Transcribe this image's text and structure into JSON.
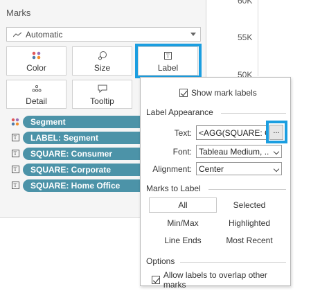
{
  "marks": {
    "title": "Marks",
    "mark_type": "Automatic",
    "tiles": [
      {
        "label": "Color"
      },
      {
        "label": "Size"
      },
      {
        "label": "Label"
      },
      {
        "label": "Detail"
      },
      {
        "label": "Tooltip"
      }
    ],
    "pills": [
      {
        "label": "Segment",
        "icon": "color-dots-icon"
      },
      {
        "label": "LABEL: Segment",
        "icon": "text-icon"
      },
      {
        "label": "SQUARE: Consumer",
        "icon": "text-icon"
      },
      {
        "label": "SQUARE: Corporate",
        "icon": "text-icon"
      },
      {
        "label": "SQUARE: Home Office",
        "icon": "text-icon"
      }
    ]
  },
  "axis": {
    "ticks": [
      "60K",
      "55K",
      "50K"
    ]
  },
  "label_popup": {
    "show_mark_labels": "Show mark labels",
    "appearance_header": "Label Appearance",
    "text_label": "Text:",
    "text_value": "<AGG(SQUARE: Co",
    "dots_button": "...",
    "font_label": "Font:",
    "font_value": "Tableau Medium, ..",
    "alignment_label": "Alignment:",
    "alignment_value": "Center",
    "marks_to_label_header": "Marks to Label",
    "options_list": [
      "All",
      "Selected",
      "Min/Max",
      "Highlighted",
      "Line Ends",
      "Most Recent"
    ],
    "options_header": "Options",
    "overlap_label": "Allow labels to overlap other marks"
  },
  "colors": {
    "pill": "#4c93a8",
    "highlight": "#1b9ee0",
    "color_dots": [
      "#e15759",
      "#9c6fb6",
      "#4e79a7",
      "#f28e2b"
    ]
  }
}
